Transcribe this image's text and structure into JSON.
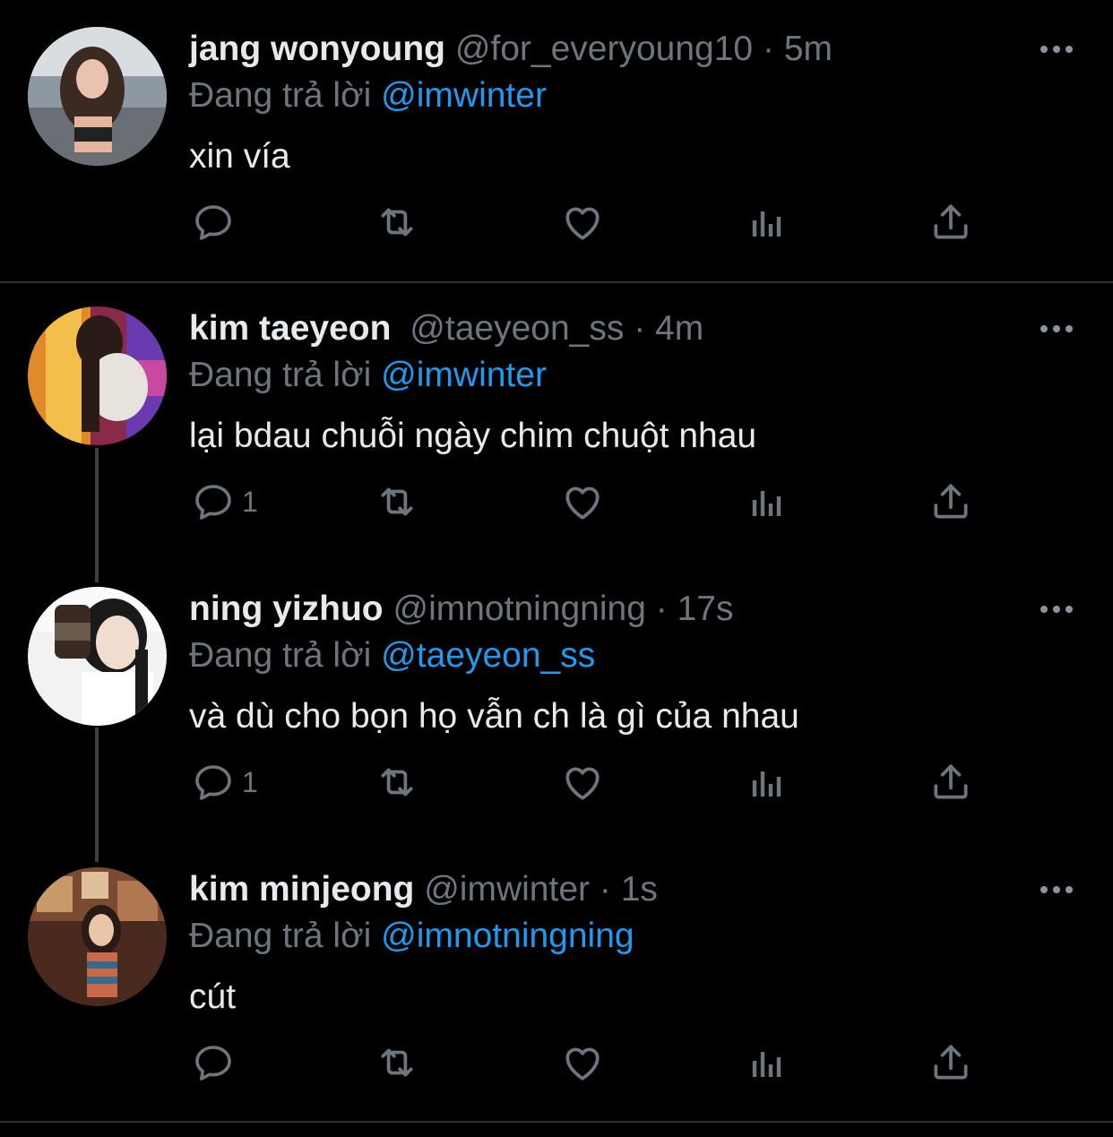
{
  "colors": {
    "background": "#000000",
    "text": "#e7e9ea",
    "secondary": "#6e767d",
    "mention": "#1d9bf0",
    "divider": "#2f3336"
  },
  "tweets": [
    {
      "name": "jang wonyoung",
      "handle": "@for_everyoung10",
      "separator": "·",
      "time": "5m",
      "replying_prefix": "Đang trả lời",
      "replying_to": "@imwinter",
      "text": "xin vía",
      "reply_count": "",
      "avatar_icon": "profile-photo"
    },
    {
      "name": "kim taeyeon",
      "handle": "@taeyeon_ss",
      "separator": "·",
      "time": "4m",
      "replying_prefix": "Đang trả lời",
      "replying_to": "@imwinter",
      "text": "lại bdau chuỗi ngày chim chuột nhau",
      "reply_count": "1",
      "avatar_icon": "profile-photo"
    },
    {
      "name": "ning yizhuo",
      "handle": "@imnotningning",
      "separator": "·",
      "time": "17s",
      "replying_prefix": "Đang trả lời",
      "replying_to": "@taeyeon_ss",
      "text": "và dù cho bọn họ vẫn ch là gì của nhau",
      "reply_count": "1",
      "avatar_icon": "profile-photo"
    },
    {
      "name": "kim minjeong",
      "handle": "@imwinter",
      "separator": "·",
      "time": "1s",
      "replying_prefix": "Đang trả lời",
      "replying_to": "@imnotningning",
      "text": "cút",
      "reply_count": "",
      "avatar_icon": "profile-photo"
    }
  ],
  "action_icons": [
    "reply-icon",
    "retweet-icon",
    "like-icon",
    "analytics-icon",
    "share-icon"
  ]
}
